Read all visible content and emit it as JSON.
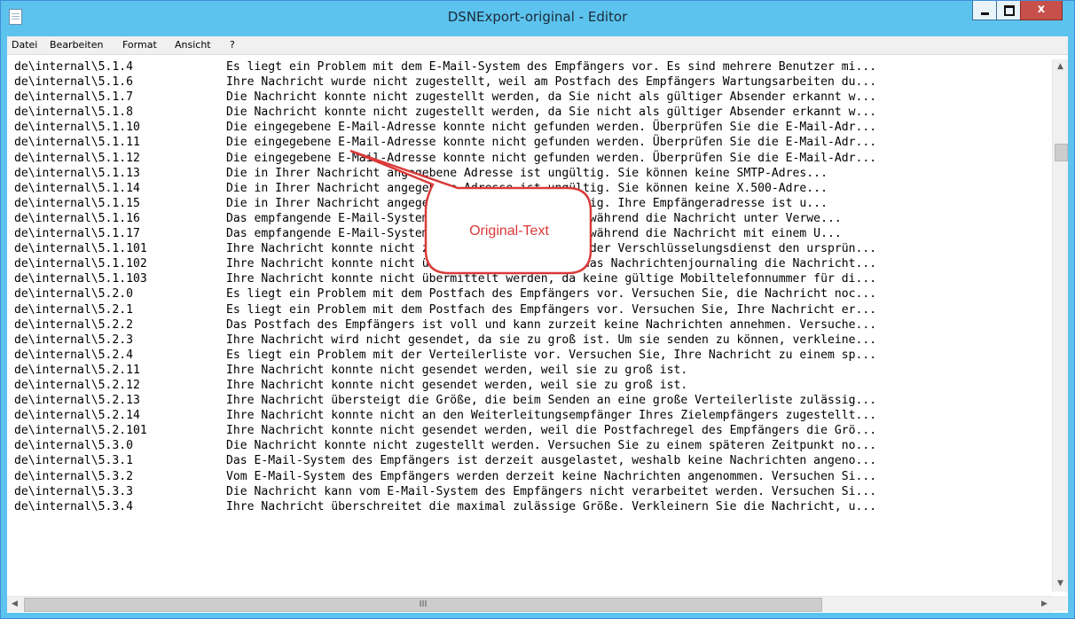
{
  "window": {
    "title": "DSNExport-original - Editor",
    "controls": [
      "minimize",
      "maximize",
      "close"
    ],
    "close_glyph": "x"
  },
  "menu": [
    "Datei",
    "Bearbeiten",
    "Format",
    "Ansicht",
    "?"
  ],
  "lines": [
    {
      "code": "de\\internal\\5.1.4",
      "message": "Es liegt ein Problem mit dem E-Mail-System des Empfängers vor. Es sind mehrere Benutzer mi..."
    },
    {
      "code": "de\\internal\\5.1.6",
      "message": "Ihre Nachricht wurde nicht zugestellt, weil am Postfach des Empfängers Wartungsarbeiten du..."
    },
    {
      "code": "de\\internal\\5.1.7",
      "message": "Die Nachricht konnte nicht zugestellt werden, da Sie nicht als gültiger Absender erkannt w..."
    },
    {
      "code": "de\\internal\\5.1.8",
      "message": "Die Nachricht konnte nicht zugestellt werden, da Sie nicht als gültiger Absender erkannt w..."
    },
    {
      "code": "de\\internal\\5.1.10",
      "message": "Die eingegebene E-Mail-Adresse konnte nicht gefunden werden. Überprüfen Sie die E-Mail-Adr..."
    },
    {
      "code": "de\\internal\\5.1.11",
      "message": "Die eingegebene E-Mail-Adresse konnte nicht gefunden werden. Überprüfen Sie die E-Mail-Adr..."
    },
    {
      "code": "de\\internal\\5.1.12",
      "message": "Die eingegebene E-Mail-Adresse konnte nicht gefunden werden. Überprüfen Sie die E-Mail-Adr..."
    },
    {
      "code": "de\\internal\\5.1.13",
      "message": "Die in Ihrer Nachricht angegebene Adresse ist ungültig. Sie können keine SMTP-Adres..."
    },
    {
      "code": "de\\internal\\5.1.14",
      "message": "Die in Ihrer Nachricht angegebene Adresse ist ungültig. Sie können keine X.500-Adre..."
    },
    {
      "code": "de\\internal\\5.1.15",
      "message": "Die in Ihrer Nachricht angegebene Adresse ist ungültig. Ihre Empfängeradresse ist u..."
    },
    {
      "code": "de\\internal\\5.1.16",
      "message": "Das empfangende E-Mail-System unterstützt SMTPUTF8, während die Nachricht unter Verwe..."
    },
    {
      "code": "de\\internal\\5.1.17",
      "message": "Das empfangende E-Mail-System unterstützt SMTPUTF8, während die Nachricht mit einem U..."
    },
    {
      "code": "de\\internal\\5.1.101",
      "message": "Ihre Nachricht konnte nicht zugestellt werden, weil der Verschlüsselungsdienst den ursprün..."
    },
    {
      "code": "de\\internal\\5.1.102",
      "message": "Ihre Nachricht konnte nicht übermittelt werden, da das Nachrichtenjournaling die Nachricht..."
    },
    {
      "code": "de\\internal\\5.1.103",
      "message": "Ihre Nachricht konnte nicht übermittelt werden, da keine gültige Mobiltelefonnummer für di..."
    },
    {
      "code": "de\\internal\\5.2.0",
      "message": "Es liegt ein Problem mit dem Postfach des Empfängers vor. Versuchen Sie, die Nachricht noc..."
    },
    {
      "code": "de\\internal\\5.2.1",
      "message": "Es liegt ein Problem mit dem Postfach des Empfängers vor. Versuchen Sie, Ihre Nachricht er..."
    },
    {
      "code": "de\\internal\\5.2.2",
      "message": "Das Postfach des Empfängers ist voll und kann zurzeit keine Nachrichten annehmen. Versuche..."
    },
    {
      "code": "de\\internal\\5.2.3",
      "message": "Ihre Nachricht wird nicht gesendet, da sie zu groß ist. Um sie senden zu können, verkleine..."
    },
    {
      "code": "de\\internal\\5.2.4",
      "message": "Es liegt ein Problem mit der Verteilerliste vor. Versuchen Sie, Ihre Nachricht zu einem sp..."
    },
    {
      "code": "de\\internal\\5.2.11",
      "message": "Ihre Nachricht konnte nicht gesendet werden, weil sie zu groß ist."
    },
    {
      "code": "de\\internal\\5.2.12",
      "message": "Ihre Nachricht konnte nicht gesendet werden, weil sie zu groß ist."
    },
    {
      "code": "de\\internal\\5.2.13",
      "message": "Ihre Nachricht übersteigt die Größe, die beim Senden an eine große Verteilerliste zulässig..."
    },
    {
      "code": "de\\internal\\5.2.14",
      "message": "Ihre Nachricht konnte nicht an den Weiterleitungsempfänger Ihres Zielempfängers zugestellt..."
    },
    {
      "code": "de\\internal\\5.2.101",
      "message": "Ihre Nachricht konnte nicht gesendet werden, weil die Postfachregel des Empfängers die Grö..."
    },
    {
      "code": "de\\internal\\5.3.0",
      "message": "Die Nachricht konnte nicht zugestellt werden. Versuchen Sie zu einem späteren Zeitpunkt no..."
    },
    {
      "code": "de\\internal\\5.3.1",
      "message": "Das E-Mail-System des Empfängers ist derzeit ausgelastet, weshalb keine Nachrichten angeno..."
    },
    {
      "code": "de\\internal\\5.3.2",
      "message": "Vom E-Mail-System des Empfängers werden derzeit keine Nachrichten angenommen. Versuchen Si..."
    },
    {
      "code": "de\\internal\\5.3.3",
      "message": "Die Nachricht kann vom E-Mail-System des Empfängers nicht verarbeitet werden. Versuchen Si..."
    },
    {
      "code": "de\\internal\\5.3.4",
      "message": "Ihre Nachricht überschreitet die maximal zulässige Größe. Verkleinern Sie die Nachricht, u..."
    }
  ],
  "callout": {
    "text": "Original-Text",
    "color": "#d93a3a"
  },
  "scrollbar": {
    "up_icon": "chevron-up",
    "down_icon": "chevron-down",
    "left_icon": "chevron-left",
    "right_icon": "chevron-right",
    "grip": "III"
  }
}
